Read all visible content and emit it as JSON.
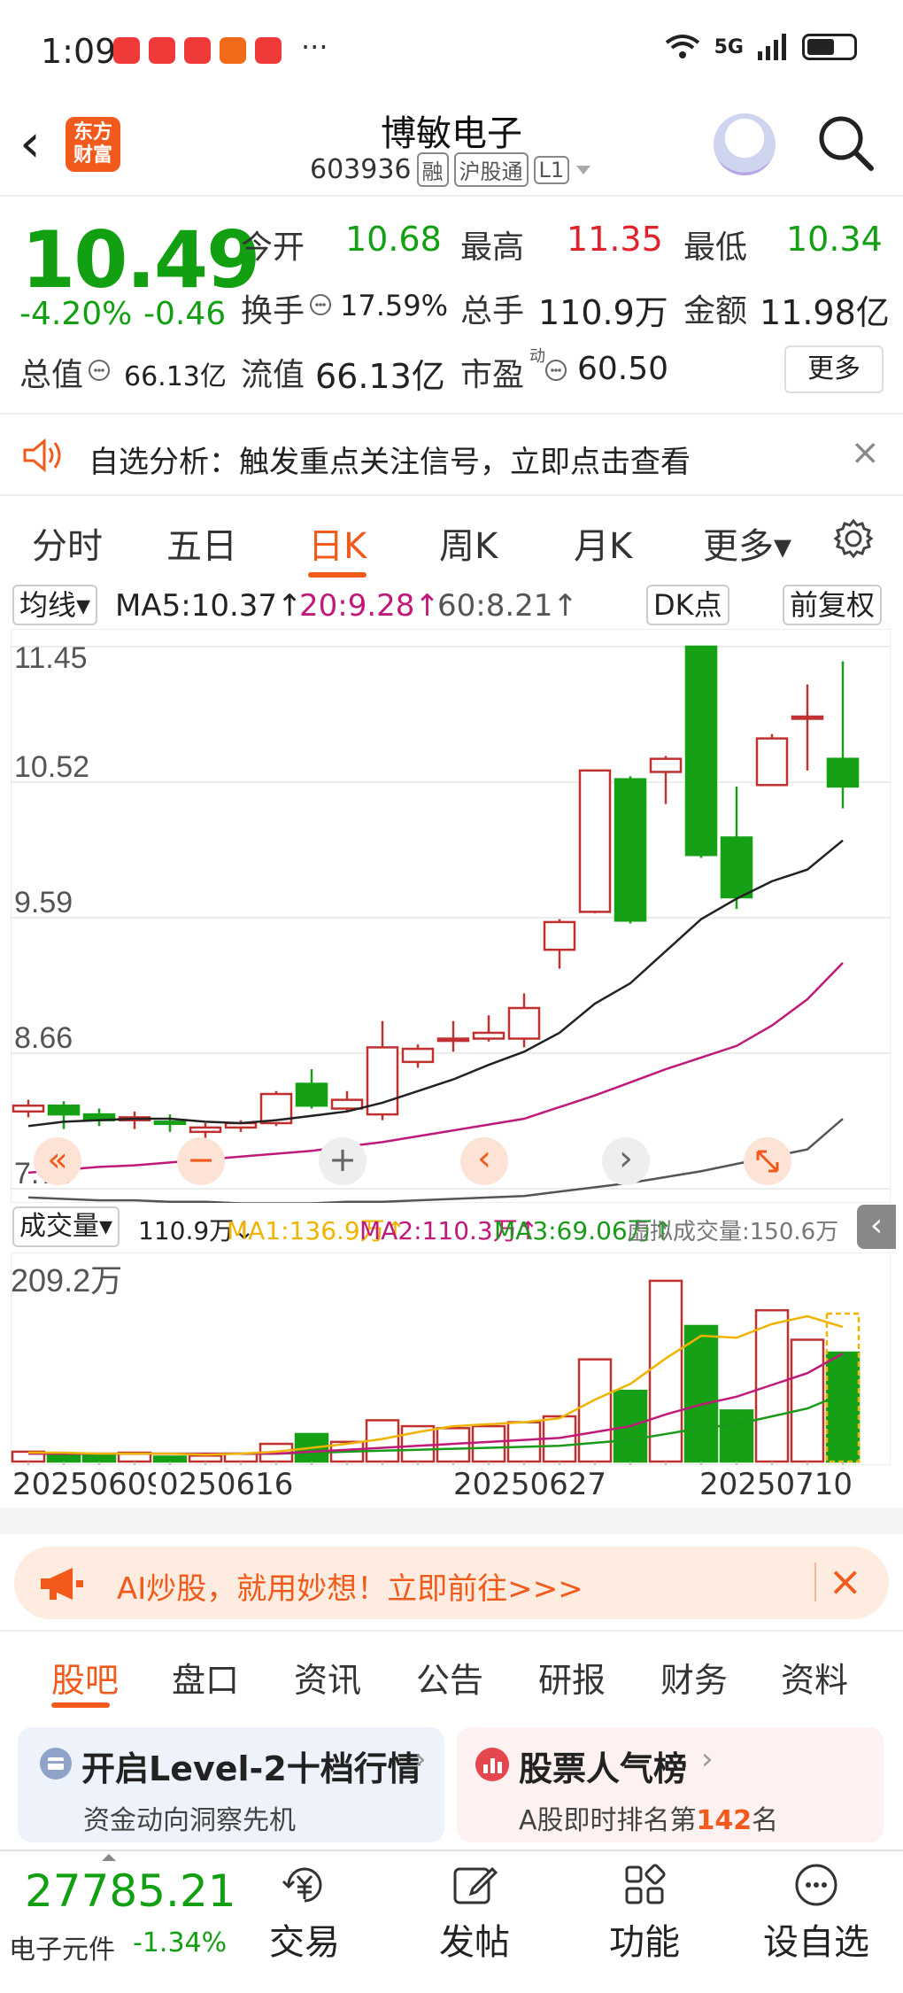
{
  "status": {
    "time": "1:09",
    "more": "···",
    "network": "5G"
  },
  "header": {
    "back": "‹",
    "logo_text": "东方财富",
    "name": "博敏电子",
    "code": "603936",
    "tags": [
      "融",
      "沪股通",
      "L1"
    ]
  },
  "quote": {
    "price": "10.49",
    "change_pct": "-4.20%",
    "change": "-0.46",
    "open_label": "今开",
    "open": "10.68",
    "high_label": "最高",
    "high": "11.35",
    "low_label": "最低",
    "low": "10.34",
    "turnover_label": "换手",
    "turnover": "17.59%",
    "volume_label": "总手",
    "volume": "110.9万",
    "amount_label": "金额",
    "amount": "11.98亿",
    "mktcap_label": "总值",
    "mktcap": "66.13亿",
    "float_label": "流值",
    "float": "66.13亿",
    "pe_label": "市盈",
    "pe_sup": "动",
    "pe": "60.50",
    "more": "更多"
  },
  "alert": {
    "text": "自选分析：触发重点关注信号，立即点击查看",
    "close": "×"
  },
  "tabs": [
    "分时",
    "五日",
    "日K",
    "周K",
    "月K",
    "更多▾"
  ],
  "active_tab": "日K",
  "ma": {
    "dropdown": "均线▾",
    "ma5": "MA5:10.37↑",
    "ma20": "20:9.28↑",
    "ma60": "60:8.21↑",
    "dk": "DK点",
    "adjust": "前复权",
    "colors": {
      "ma5": "#222222",
      "ma20": "#c0197a",
      "ma60": "#555555"
    }
  },
  "volume_row": {
    "dropdown": "成交量▾",
    "vol": "110.9万↓",
    "ma1": "MA1:136.9万↑",
    "ma2": "MA2:110.3万↑",
    "ma3": "MA3:69.06万↑",
    "virtual": "虚拟成交量:150.6万",
    "colors": {
      "ma1": "#f0b400",
      "ma2": "#c0197a",
      "ma3": "#1a9a1a"
    }
  },
  "chart_data": [
    {
      "type": "candlestick",
      "yticks": [
        "11.45",
        "10.52",
        "9.59",
        "8.66",
        "7.73"
      ],
      "ylim": [
        7.73,
        11.45
      ],
      "dates": [
        "20250609",
        "20250616",
        "20250627",
        "20250710"
      ],
      "candles": [
        {
          "o": 8.26,
          "c": 8.3,
          "h": 8.34,
          "l": 8.22
        },
        {
          "o": 8.3,
          "c": 8.24,
          "h": 8.33,
          "l": 8.14
        },
        {
          "o": 8.24,
          "c": 8.2,
          "h": 8.28,
          "l": 8.16
        },
        {
          "o": 8.2,
          "c": 8.22,
          "h": 8.26,
          "l": 8.14
        },
        {
          "o": 8.19,
          "c": 8.18,
          "h": 8.24,
          "l": 8.12
        },
        {
          "o": 8.12,
          "c": 8.15,
          "h": 8.18,
          "l": 8.05
        },
        {
          "o": 8.15,
          "c": 8.18,
          "h": 8.2,
          "l": 8.12
        },
        {
          "o": 8.18,
          "c": 8.38,
          "h": 8.4,
          "l": 8.16
        },
        {
          "o": 8.45,
          "c": 8.3,
          "h": 8.55,
          "l": 8.28
        },
        {
          "o": 8.28,
          "c": 8.34,
          "h": 8.4,
          "l": 8.26
        },
        {
          "o": 8.24,
          "c": 8.7,
          "h": 8.88,
          "l": 8.2
        },
        {
          "o": 8.6,
          "c": 8.69,
          "h": 8.72,
          "l": 8.56
        },
        {
          "o": 8.76,
          "c": 8.76,
          "h": 8.88,
          "l": 8.67
        },
        {
          "o": 8.76,
          "c": 8.8,
          "h": 8.92,
          "l": 8.74
        },
        {
          "o": 8.76,
          "c": 8.97,
          "h": 9.07,
          "l": 8.7
        },
        {
          "o": 9.37,
          "c": 9.56,
          "h": 9.58,
          "l": 9.24
        },
        {
          "o": 9.63,
          "c": 10.6,
          "h": 10.6,
          "l": 9.62
        },
        {
          "o": 10.54,
          "c": 9.57,
          "h": 10.56,
          "l": 9.55
        },
        {
          "o": 10.59,
          "c": 10.68,
          "h": 10.7,
          "l": 10.37
        },
        {
          "o": 11.45,
          "c": 10.02,
          "h": 11.45,
          "l": 10.0
        },
        {
          "o": 10.14,
          "c": 9.73,
          "h": 10.49,
          "l": 9.65
        },
        {
          "o": 10.5,
          "c": 10.82,
          "h": 10.85,
          "l": 10.5
        },
        {
          "o": 10.97,
          "c": 10.97,
          "h": 11.19,
          "l": 10.6
        },
        {
          "o": 10.68,
          "c": 10.49,
          "h": 11.35,
          "l": 10.34
        }
      ],
      "ma5": [
        8.16,
        8.19,
        8.2,
        8.21,
        8.21,
        8.19,
        8.18,
        8.2,
        8.23,
        8.26,
        8.32,
        8.4,
        8.48,
        8.58,
        8.67,
        8.8,
        9.0,
        9.14,
        9.36,
        9.58,
        9.72,
        9.84,
        9.92,
        10.12
      ],
      "ma20": [
        7.84,
        7.86,
        7.88,
        7.89,
        7.91,
        7.93,
        7.95,
        7.97,
        7.99,
        8.02,
        8.05,
        8.09,
        8.13,
        8.17,
        8.21,
        8.29,
        8.37,
        8.46,
        8.55,
        8.63,
        8.71,
        8.85,
        9.03,
        9.28
      ],
      "ma60": [
        7.67,
        7.66,
        7.65,
        7.65,
        7.64,
        7.64,
        7.63,
        7.63,
        7.63,
        7.64,
        7.64,
        7.65,
        7.66,
        7.67,
        7.68,
        7.71,
        7.74,
        7.77,
        7.81,
        7.85,
        7.9,
        7.95,
        8.0,
        8.21
      ]
    },
    {
      "type": "bar",
      "ytick": "209.2万",
      "ylim": [
        0,
        209.2
      ],
      "values": [
        10,
        8,
        7,
        9,
        5,
        6,
        8,
        18,
        28,
        20,
        42,
        36,
        34,
        36,
        40,
        46,
        104,
        72,
        184,
        138,
        52,
        154,
        124,
        110.9
      ],
      "ma1": [
        9,
        9,
        8,
        8,
        8,
        7,
        8,
        10,
        14,
        18,
        23,
        30,
        36,
        38,
        40,
        44,
        63,
        79,
        105,
        128,
        126,
        140,
        148,
        137
      ],
      "ma2": [
        8,
        8,
        8,
        8,
        8,
        8,
        8,
        8,
        10,
        12,
        14,
        16,
        18,
        20,
        22,
        24,
        30,
        36,
        48,
        58,
        66,
        78,
        90,
        110
      ],
      "ma3": [
        8,
        8,
        8,
        8,
        8,
        8,
        8,
        8,
        9,
        10,
        11,
        12,
        13,
        14,
        15,
        16,
        19,
        22,
        28,
        34,
        38,
        46,
        54,
        69
      ]
    }
  ],
  "chart_controls": {
    "first": "«",
    "minus": "−",
    "plus": "+",
    "prev": "‹",
    "next": "›"
  },
  "ad": {
    "text": "AI炒股，就用妙想！立即前往>>>",
    "close": "×"
  },
  "bottom_tabs": [
    "股吧",
    "盘口",
    "资讯",
    "公告",
    "研报",
    "财务",
    "资料"
  ],
  "cards": [
    {
      "title": "开启Level-2十档行情",
      "sub": "资金动向洞察先机"
    },
    {
      "title": "股票人气榜",
      "sub_prefix": "A股即时排名第",
      "rank": "142",
      "sub_suffix": "名"
    }
  ],
  "index": {
    "value": "27785.21",
    "name": "电子元件",
    "change": "-1.34%"
  },
  "nav": [
    "交易",
    "发帖",
    "功能",
    "设自选"
  ]
}
